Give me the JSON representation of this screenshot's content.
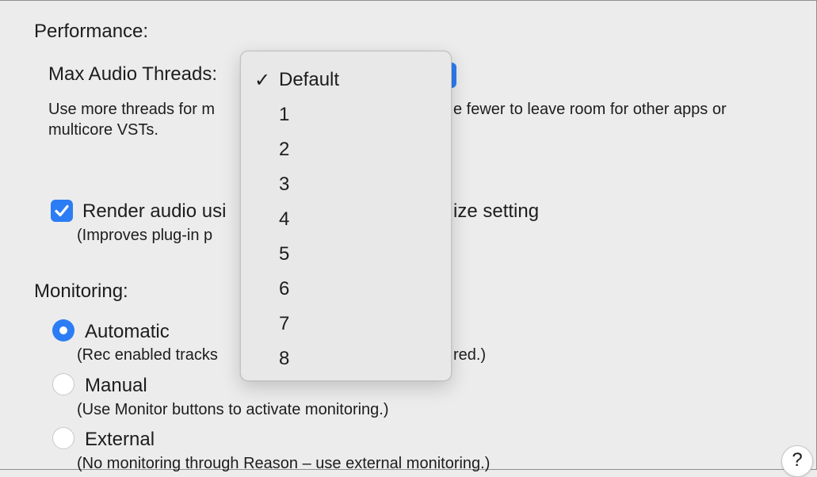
{
  "performance": {
    "heading": "Performance:",
    "max_threads_label": "Max Audio Threads:",
    "threads_desc_line1_left": "Use more threads for m",
    "threads_desc_line1_right": "e fewer to leave room for other apps or",
    "threads_desc_line2": "multicore VSTs.",
    "render_checkbox_checked": true,
    "render_label_left": "Render audio usi",
    "render_label_right": "ize setting",
    "render_desc": "(Improves plug-in p"
  },
  "monitoring": {
    "heading": "Monitoring:",
    "selected": "Automatic",
    "options": [
      {
        "label": "Automatic",
        "desc_left": "(Rec enabled tracks",
        "desc_right": "red.)"
      },
      {
        "label": "Manual",
        "desc": "(Use Monitor buttons to activate monitoring.)"
      },
      {
        "label": "External",
        "desc": "(No monitoring through Reason – use external monitoring.)"
      }
    ]
  },
  "threads_menu": {
    "check_glyph": "✓",
    "selected": "Default",
    "items": [
      "Default",
      "1",
      "2",
      "3",
      "4",
      "5",
      "6",
      "7",
      "8"
    ]
  },
  "help_button": {
    "label": "?"
  },
  "colors": {
    "accent": "#2c7df5",
    "background": "#ececec",
    "menu": "#e8e8e8"
  },
  "icons": {
    "checkbox": "checkmark-icon",
    "help": "question-mark-icon"
  }
}
